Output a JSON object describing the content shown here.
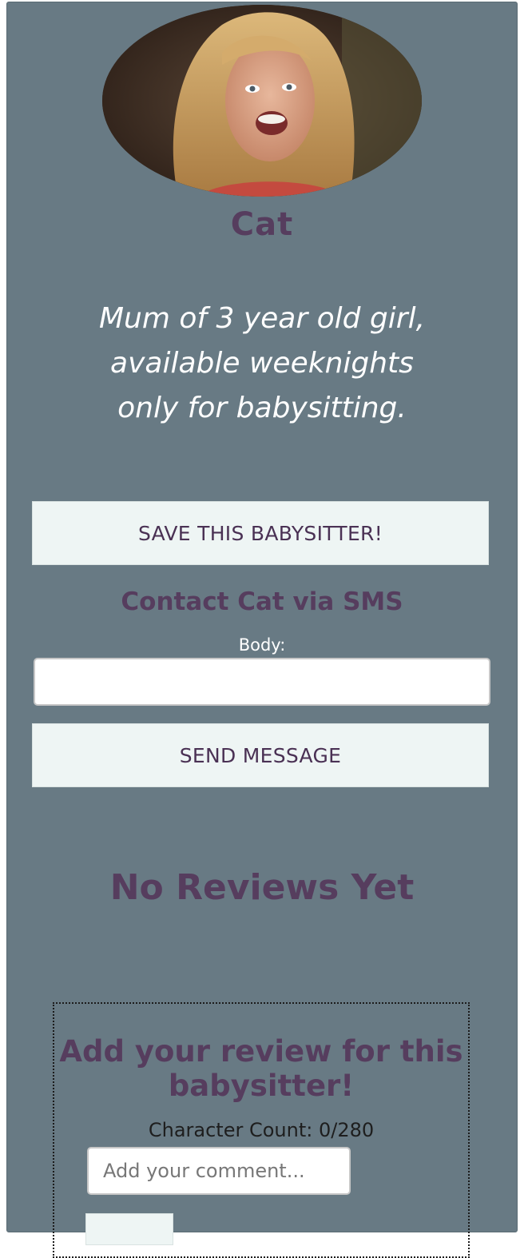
{
  "profile": {
    "name": "Cat",
    "bio": "Mum of 3 year old girl, available weeknights only for babysitting."
  },
  "actions": {
    "save_label": "SAVE THIS BABYSITTER!",
    "send_label": "SEND MESSAGE"
  },
  "contact": {
    "heading": "Contact Cat via SMS",
    "body_label": "Body:",
    "body_value": ""
  },
  "reviews": {
    "empty_text": "No Reviews Yet"
  },
  "review_form": {
    "heading": "Add your review for this babysitter!",
    "char_count": "Character Count: 0/280",
    "comment_placeholder": "Add your comment...",
    "comment_value": ""
  },
  "colors": {
    "card_bg": "#687a84",
    "accent_purple": "#563d5e",
    "button_bg": "#eef5f4"
  }
}
